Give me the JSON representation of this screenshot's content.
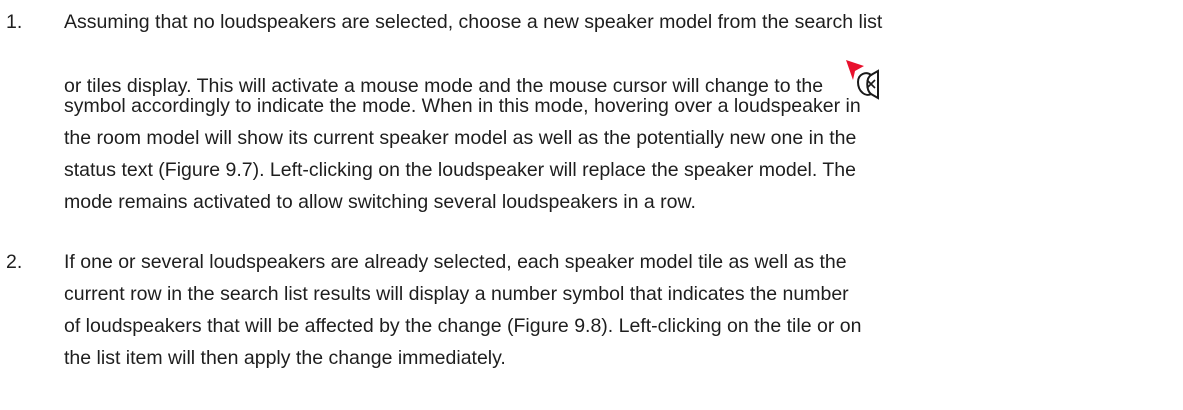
{
  "items": [
    {
      "number": "1.",
      "lines": [
        "Assuming that no loudspeakers are selected, choose a new speaker model from the search list",
        "or tiles display. This will activate a mouse mode and the mouse cursor will change to the",
        "symbol accordingly to indicate the mode. When in this mode, hovering over a loudspeaker in",
        "the room model will show its current speaker model as well as the potentially new one in the",
        "status text (Figure 9.7). Left-clicking on the loudspeaker will replace the speaker model. The",
        "mode remains activated to allow switching several loudspeakers in a row."
      ]
    },
    {
      "number": "2.",
      "lines": [
        "If one or several loudspeakers are already selected, each speaker model tile as well as the",
        "current row in the search list results will display a number symbol that indicates the number",
        "of loudspeakers that will be affected by the change (Figure 9.8). Left-clicking on the tile or on",
        "the list item will then apply the change immediately."
      ]
    }
  ],
  "icons": {
    "replace_cursor": "speaker-replace-cursor-icon"
  },
  "colors": {
    "text": "#1e1e1e",
    "cursor_arrow": "#e8112d",
    "icon_stroke": "#1a1a1a"
  }
}
